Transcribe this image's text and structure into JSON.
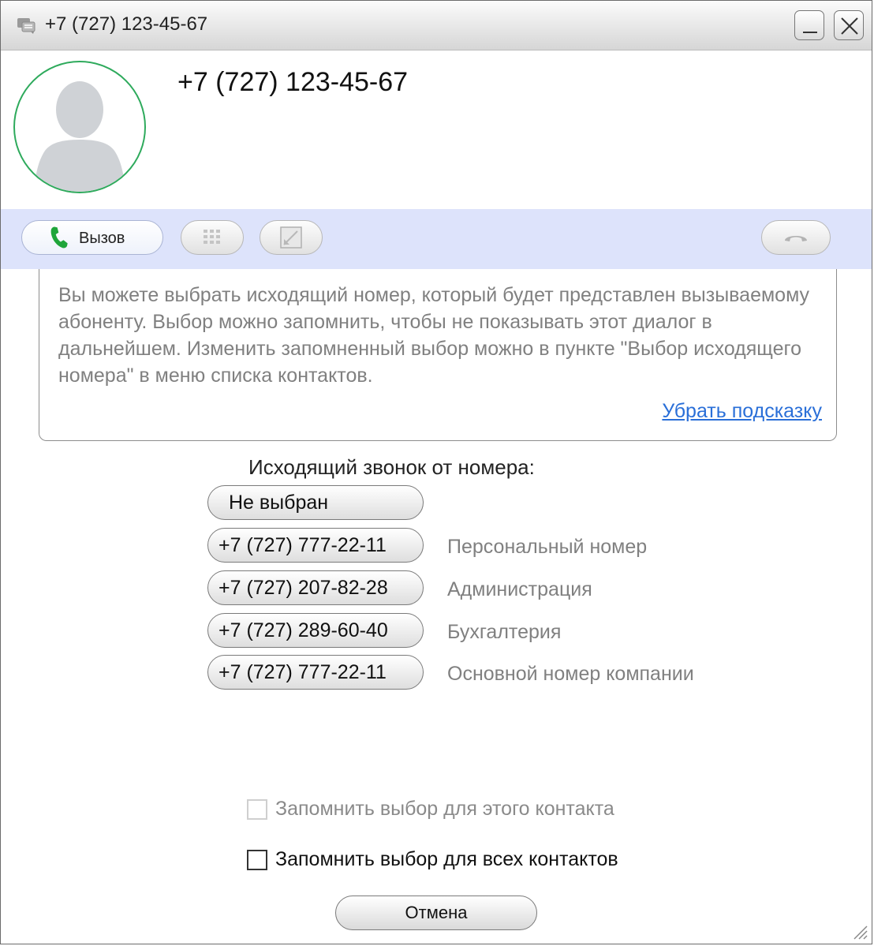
{
  "window": {
    "title": "+7 (727) 123-45-67",
    "minimize_icon": "minimize-icon",
    "close_icon": "close-icon",
    "title_icon": "chat-icon"
  },
  "contact": {
    "name": "+7 (727) 123-45-67",
    "avatar_icon": "person-silhouette-icon",
    "avatar_border_color": "#2eaa5c"
  },
  "toolbar": {
    "background_color": "#dde3fb",
    "call_label": "Вызов",
    "call_icon": "phone-icon",
    "keypad_icon": "keypad-icon",
    "transfer_icon": "transfer-icon",
    "hangup_icon": "hangup-icon"
  },
  "hint": {
    "text": "Вы можете выбрать исходящий номер, который будет представлен вызываемому абоненту. Выбор можно запомнить, чтобы не показывать этот диалог в дальнейшем. Изменить запомненный выбор можно в пункте \"Выбор исходящего номера\" в меню списка контактов.",
    "dismiss_link": "Убрать подсказку"
  },
  "outgoing": {
    "label": "Исходящий звонок от номера:",
    "none_option": "Не выбран",
    "numbers": [
      {
        "number": "+7 (727) 777-22-11",
        "description": "Персональный номер"
      },
      {
        "number": "+7 (727) 207-82-28",
        "description": "Администрация"
      },
      {
        "number": "+7 (727) 289-60-40",
        "description": "Бухгалтерия"
      },
      {
        "number": "+7 (727) 777-22-11",
        "description": "Основной номер компании"
      }
    ]
  },
  "options": {
    "remember_contact": {
      "label": "Запомнить выбор для этого контакта",
      "checked": false,
      "enabled": false
    },
    "remember_all": {
      "label": "Запомнить выбор для всех контактов",
      "checked": false,
      "enabled": true
    }
  },
  "footer": {
    "cancel_label": "Отмена"
  }
}
